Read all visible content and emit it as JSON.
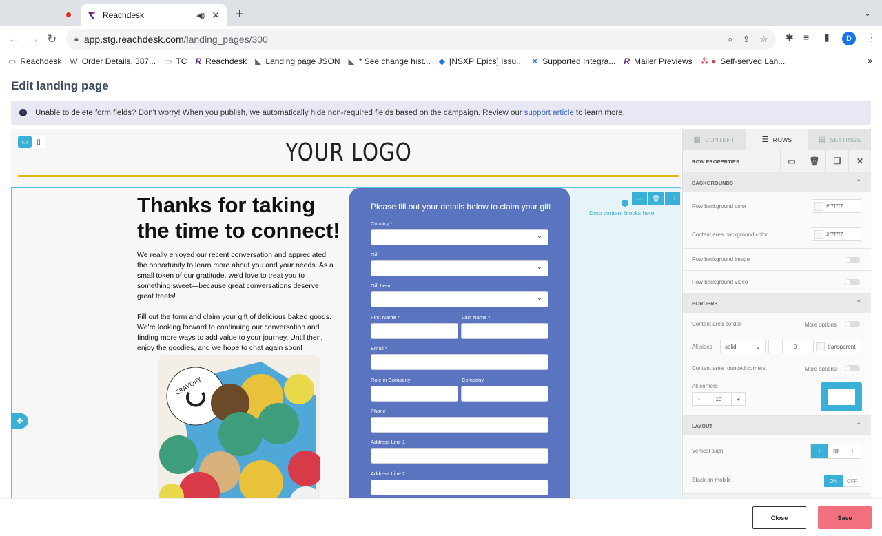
{
  "browser": {
    "tab_title": "Reachdesk",
    "url_host": "app.stg.reachdesk.com",
    "url_path": "/landing_pages/300",
    "profile_initial": "D",
    "bookmarks": [
      {
        "icon": "folder-icon",
        "label": "Reachdesk"
      },
      {
        "icon": "wordpress-icon",
        "label": "Order Details, 387..."
      },
      {
        "icon": "folder-icon",
        "label": "TC"
      },
      {
        "icon": "reachdesk-icon",
        "label": "Reachdesk"
      },
      {
        "icon": "chart-icon",
        "label": "Landing page JSON"
      },
      {
        "icon": "chart-icon",
        "label": "* See change hist..."
      },
      {
        "icon": "jira-icon",
        "label": "[NSXP Epics] Issu..."
      },
      {
        "icon": "confluence-icon",
        "label": "Supported Integra..."
      },
      {
        "icon": "reachdesk-icon",
        "label": "Mailer Previews"
      },
      {
        "icon": "dots-icon",
        "label": "Self-served Lan..."
      }
    ],
    "bookmarks_more": "»"
  },
  "page": {
    "title": "Edit landing page",
    "banner_text": "Unable to delete form fields? Don't worry! When you publish, we automatically hide non-required fields based on the campaign. Review our",
    "banner_link": "support article",
    "banner_suffix": "to learn more."
  },
  "canvas": {
    "logo": "YOUR LOGO",
    "heading": "Thanks for taking the time to connect!",
    "para1": "We really enjoyed our recent conversation and appreciated the opportunity to learn more about you and your needs. As a small token of our gratitude, we'd love to treat you to something sweet—because great conversations deserve great treats!",
    "para2": "Fill out the form and claim your gift of delicious baked goods. We're looking forward to continuing our conversation and finding more ways to add value to your journey. Until then, enjoy the goodies, and we hope to chat again soon!",
    "photo_brand": "CRAVORY COOKIES",
    "drop_text": "Drop content blocks here",
    "form": {
      "title": "Please fill out your details below to claim your gift",
      "fields": {
        "country": "Country *",
        "gift": "Gift",
        "gift_item": "Gift Item",
        "first_name": "First Name *",
        "last_name": "Last Name *",
        "email": "Email *",
        "role": "Role in Company",
        "company": "Company",
        "phone": "Phone",
        "address1": "Address Line 1",
        "address2": "Address Line 2"
      }
    }
  },
  "panel": {
    "tabs": [
      "CONTENT",
      "ROWS",
      "SETTINGS"
    ],
    "row_properties": "ROW PROPERTIES",
    "backgrounds": "BACKGROUNDS",
    "row_bg_color": "Row background color",
    "row_bg_color_value": "#f7f7f7",
    "content_bg_color": "Content area background color",
    "content_bg_color_value": "#f7f7f7",
    "row_bg_image": "Row background image",
    "row_bg_video": "Row background video",
    "borders": "BORDERS",
    "content_border": "Content area border",
    "more_options": "More options",
    "all_sides": "All sides",
    "border_style": "solid",
    "border_width": "0",
    "border_color": "transparent",
    "rounded_corners": "Content area rounded corners",
    "all_corners": "All corners",
    "corner_value": "10",
    "layout": "LAYOUT",
    "vertical_align": "Vertical align",
    "stack_mobile": "Stack on mobile",
    "on": "ON",
    "off": "OFF"
  },
  "footer": {
    "close": "Close",
    "save": "Save"
  },
  "colors": {
    "accent": "#3ab0d8",
    "form_bg": "#5b74c0",
    "save_btn": "#f2707e",
    "logo_line": "#e0b820"
  }
}
